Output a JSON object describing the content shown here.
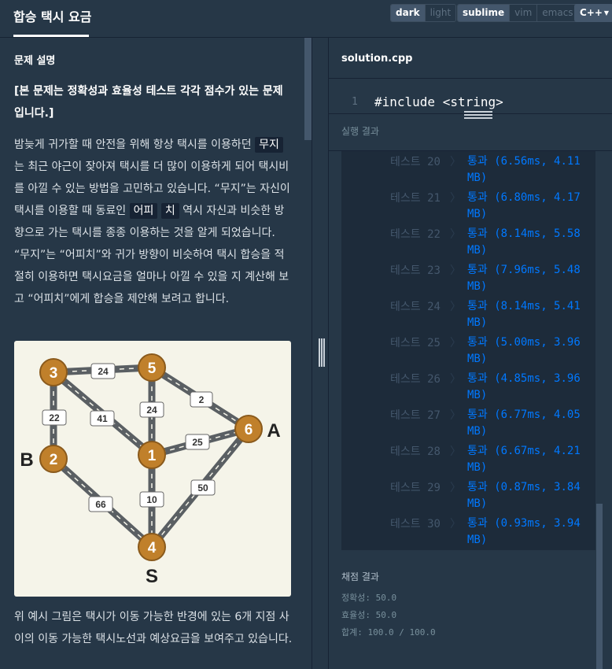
{
  "header": {
    "title": "합승 택시 요금",
    "theme": {
      "options": [
        "dark",
        "light"
      ],
      "selected": "dark"
    },
    "keymap": {
      "options": [
        "sublime",
        "vim",
        "emacs"
      ],
      "selected": "sublime"
    },
    "language": "C++"
  },
  "problem": {
    "section_title": "문제 설명",
    "bold_note": "[본 문제는 정확성과 효율성 테스트 각각 점수가 있는 문제입니다.]",
    "p1": {
      "t1": "밤늦게 귀가할 때 안전을 위해 항상 택시를 이용하던",
      "c1": "무지",
      "t2": "는 최근 야근이 잦아져 택시를 더 많이 이용하게 되어 택시비를 아낄 수 있는 방법을 고민하고 있습니다. “무지”는 자신이 택시를 이용할 때 동료인",
      "c2a": "어피",
      "c2b": "치",
      "t3": "역시 자신과 비슷한 방향으로 가는 택시를 종종 이용하는 것을 알게 되었습니다. “무지”는 “어피치”와 귀가 방향이 비슷하여 택시 합승을 적절히 이용하면 택시요금을 얼마나 아낄 수 있을 지 계산해 보고 “어피치”에게 합승을 제안해 보려고 합니다."
    },
    "p2": "위 예시 그림은 택시가 이동 가능한 반경에 있는 6개 지점 사이의 이동 가능한 택시노선과 예상요금을 보여주고 있습니다.",
    "map": {
      "nodes": [
        "3",
        "5",
        "2",
        "1",
        "6",
        "4"
      ],
      "edge_costs": [
        "24",
        "22",
        "41",
        "24",
        "2",
        "25",
        "66",
        "10",
        "50"
      ],
      "letters": {
        "a": "A",
        "b": "B",
        "s": "S"
      }
    }
  },
  "editor": {
    "filename": "solution.cpp",
    "line_number": "1",
    "code_line": "#include <string>"
  },
  "results": {
    "header": "실행 결과",
    "rows": [
      {
        "label": "테스트 20",
        "result": "통과 (6.56ms, 4.11 MB)"
      },
      {
        "label": "테스트 21",
        "result": "통과 (6.80ms, 4.17 MB)"
      },
      {
        "label": "테스트 22",
        "result": "통과 (8.14ms, 5.58 MB)"
      },
      {
        "label": "테스트 23",
        "result": "통과 (7.96ms, 5.48 MB)"
      },
      {
        "label": "테스트 24",
        "result": "통과 (8.14ms, 5.41 MB)"
      },
      {
        "label": "테스트 25",
        "result": "통과 (5.00ms, 3.96 MB)"
      },
      {
        "label": "테스트 26",
        "result": "통과 (4.85ms, 3.96 MB)"
      },
      {
        "label": "테스트 27",
        "result": "통과 (6.77ms, 4.05 MB)"
      },
      {
        "label": "테스트 28",
        "result": "통과 (6.67ms, 4.21 MB)"
      },
      {
        "label": "테스트 29",
        "result": "통과 (0.87ms, 3.84 MB)"
      },
      {
        "label": "테스트 30",
        "result": "통과 (0.93ms, 3.94 MB)"
      }
    ],
    "arrow_glyph": "〉"
  },
  "score": {
    "title": "채점 결과",
    "accuracy": "정확성: 50.0",
    "efficiency": "효율성: 50.0",
    "total": "합계: 100.0 / 100.0"
  },
  "colors": {
    "background": "#263747",
    "dark_panel": "#1d2b3a",
    "pass": "#0078ff",
    "node_fill": "#c0802b",
    "road": "#5a5f63",
    "map_bg": "#f5f4e9"
  }
}
